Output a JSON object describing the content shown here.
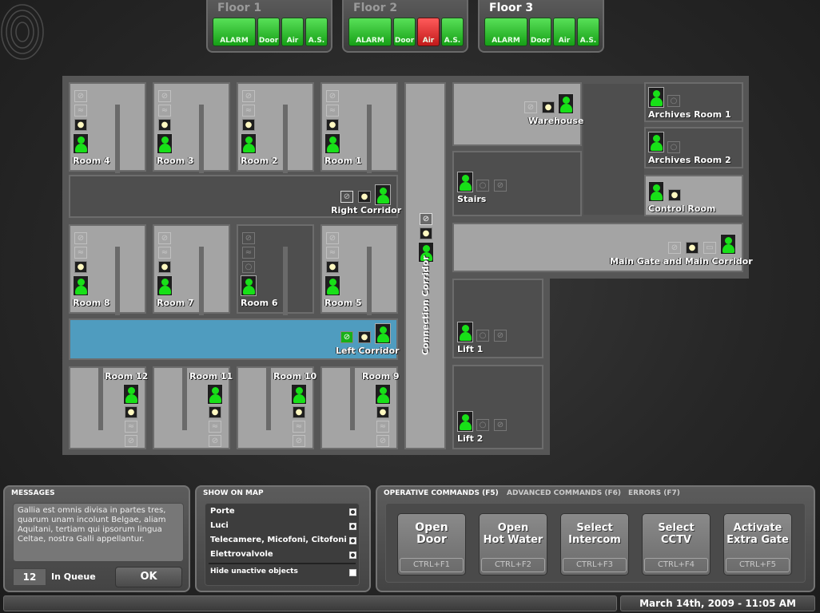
{
  "floors": [
    {
      "title": "Floor 1",
      "buttons": [
        "ALARM",
        "Door",
        "Air",
        "A.S."
      ]
    },
    {
      "title": "Floor 2",
      "buttons": [
        "ALARM",
        "Door",
        "Air",
        "A.S."
      ]
    },
    {
      "title": "Floor 3",
      "buttons": [
        "ALARM",
        "Door",
        "Air",
        "A.S."
      ]
    }
  ],
  "floor_status_colors": {
    "ok": "#2ecc2e",
    "alert": "#e02a2a"
  },
  "alert_button": {
    "floor": "Floor 2",
    "button": "Air"
  },
  "active_floor": "Floor 3",
  "map": {
    "rooms": {
      "room4": "Room 4",
      "room3": "Room 3",
      "room2": "Room 2",
      "room1": "Room 1",
      "right_corridor": "Right Corridor",
      "room8": "Room 8",
      "room7": "Room 7",
      "room6": "Room 6",
      "room5": "Room 5",
      "left_corridor": "Left Corridor",
      "room12": "Room 12",
      "room11": "Room 11",
      "room10": "Room 10",
      "room9": "Room 9",
      "connection_corridor": "Connection Corridor",
      "warehouse": "Warehouse",
      "stairs": "Stairs",
      "lift1": "Lift 1",
      "lift2": "Lift 2",
      "archives1": "Archives Room 1",
      "archives2": "Archives Room 2",
      "control_room": "Control Room",
      "main_gate": "Main Gate and Main Corridor"
    },
    "highlight_color": "#4f9cbf",
    "icons": {
      "person": "person-icon",
      "light": "light-bulb-icon",
      "door": "door-icon",
      "air": "air-icon",
      "valve": "valve-icon"
    }
  },
  "messages": {
    "title": "MESSAGES",
    "text": "Gallia est omnis divisa in partes tres, quarum unam incolunt Belgae, aliam Aquitani, tertiam qui ipsorum lingua Celtae, nostra Galli appellantur.",
    "queue_count": "12",
    "queue_label": "In Queue",
    "ok_label": "OK"
  },
  "show_on_map": {
    "title": "SHOW ON MAP",
    "items": [
      {
        "label": "Porte",
        "checked": true
      },
      {
        "label": "Luci",
        "checked": true
      },
      {
        "label": "Telecamere, Micofoni, Citofoni",
        "checked": true
      },
      {
        "label": "Elettrovalvole",
        "checked": true
      },
      {
        "label": "Hide unactive objects",
        "checked": false
      }
    ]
  },
  "commands": {
    "tabs": [
      "OPERATIVE COMMANDS (F5)",
      "ADVANCED COMMANDS (F6)",
      "ERRORS (F7)"
    ],
    "active_tab": "OPERATIVE COMMANDS (F5)",
    "buttons": [
      {
        "line1": "Open",
        "line2": "Door",
        "key": "CTRL+F1"
      },
      {
        "line1": "Open",
        "line2": "Hot Water",
        "key": "CTRL+F2"
      },
      {
        "line1": "Select",
        "line2": "Intercom",
        "key": "CTRL+F3"
      },
      {
        "line1": "Select",
        "line2": "CCTV",
        "key": "CTRL+F4"
      },
      {
        "line1": "Activate",
        "line2": "Extra Gate",
        "key": "CTRL+F5"
      }
    ]
  },
  "status_bar": {
    "datetime": "March 14th, 2009 - 11:05 AM"
  }
}
